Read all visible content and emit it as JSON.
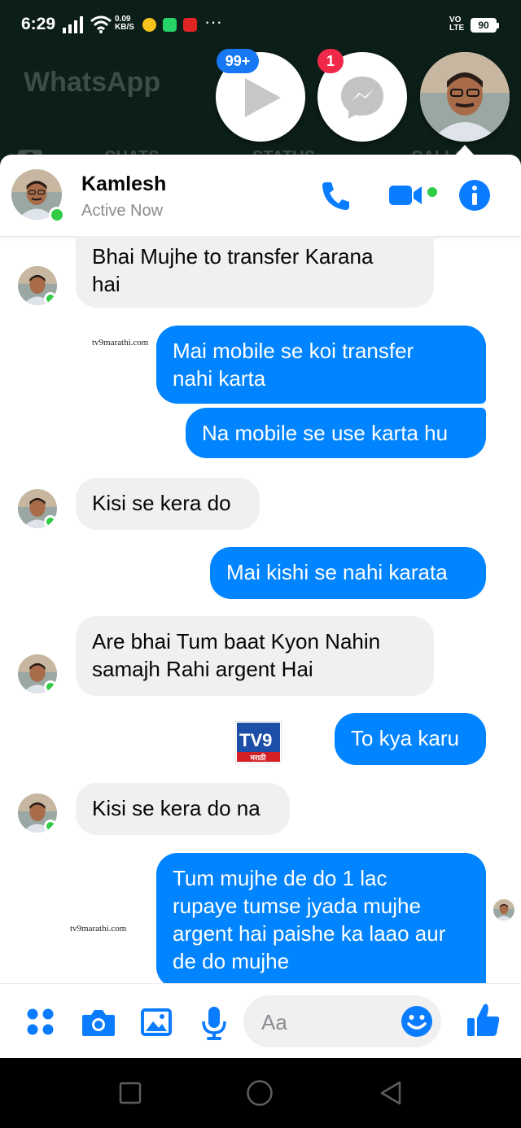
{
  "status_bar": {
    "time": "6:29",
    "net_speed_top": "0.09",
    "net_speed_bottom": "KB/S",
    "overflow": "···",
    "volte_top": "VO",
    "volte_bottom": "LTE",
    "battery": "90"
  },
  "background_app": {
    "title": "WhatsApp",
    "tabs": [
      "CHATS",
      "STATUS",
      "CALLS"
    ]
  },
  "chat_heads": [
    {
      "name": "video-app-head",
      "badge": "99+",
      "badge_color": "#1877f2"
    },
    {
      "name": "messenger-head",
      "badge": "1",
      "badge_color": "#f02849"
    },
    {
      "name": "contact-head"
    }
  ],
  "header": {
    "name": "Kamlesh",
    "status": "Active Now",
    "icons": [
      "phone-icon",
      "video-camera-icon",
      "info-icon"
    ]
  },
  "messages": [
    {
      "dir": "in",
      "lines": [
        "Bhai Mujhe to transfer Karana",
        "hai"
      ]
    },
    {
      "dir": "out",
      "lines": [
        "Mai mobile se koi transfer",
        "nahi karta"
      ]
    },
    {
      "dir": "out",
      "lines": [
        "Na mobile se use karta hu"
      ]
    },
    {
      "dir": "in",
      "lines": [
        "Kisi se kera do"
      ]
    },
    {
      "dir": "out",
      "lines": [
        "Mai kishi se nahi karata"
      ]
    },
    {
      "dir": "in",
      "lines": [
        "Are bhai Tum baat Kyon Nahin",
        "samajh Rahi argent Hai"
      ]
    },
    {
      "dir": "out",
      "lines": [
        "To kya karu"
      ]
    },
    {
      "dir": "in",
      "lines": [
        "Kisi se kera do na"
      ]
    },
    {
      "dir": "out",
      "lines": [
        "Tum mujhe de do 1 lac",
        "rupaye tumse jyada mujhe",
        "argent hai paishe ka laao aur",
        "de do mujhe"
      ]
    }
  ],
  "watermarks": [
    "tv9marathi.com",
    "tv9marathi.com"
  ],
  "logo": {
    "brand": "TV9",
    "sub": "मराठी"
  },
  "composer": {
    "placeholder": "Aa",
    "icons": [
      "apps-grid-icon",
      "camera-icon",
      "gallery-icon",
      "microphone-icon",
      "emoji-icon",
      "thumbs-up-icon"
    ]
  },
  "colors": {
    "accent": "#0084ff",
    "icon_blue": "#0a7cff",
    "incoming_bubble": "#f0f0f0",
    "online": "#31cc46",
    "whatsapp_bg": "#0b1e17"
  }
}
